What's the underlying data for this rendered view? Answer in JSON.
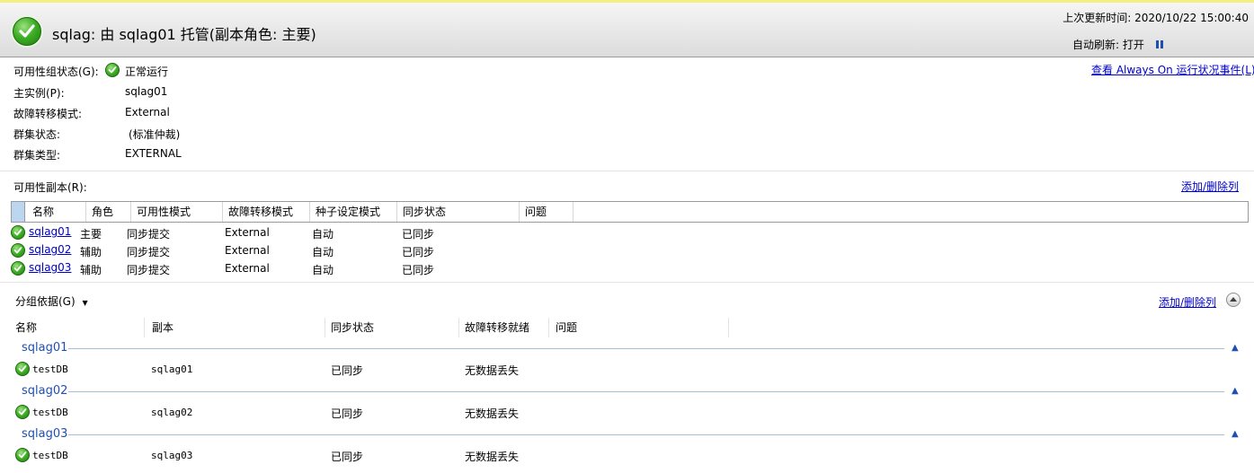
{
  "header": {
    "title": "sqlag: 由 sqlag01 托管(副本角色: 主要)",
    "last_update": "上次更新时间: 2020/10/22 15:00:40",
    "auto_refresh": "自动刷新: 打开"
  },
  "summary": {
    "state_label": "可用性组状态(G):",
    "state_value": "正常运行",
    "primary_label": "主实例(P):",
    "primary_value": "sqlag01",
    "failover_label": "故障转移模式:",
    "failover_value": "External",
    "cluster_state_label": "群集状态:",
    "cluster_state_value": "(标准仲裁)",
    "cluster_type_label": "群集类型:",
    "cluster_type_value": "EXTERNAL",
    "events_link": "查看 Always On 运行状况事件(L)"
  },
  "replicas": {
    "label": "可用性副本(R):",
    "add_remove": "添加/删除列",
    "columns": [
      "名称",
      "角色",
      "可用性模式",
      "故障转移模式",
      "种子设定模式",
      "同步状态",
      "问题"
    ],
    "rows": [
      {
        "name": "sqlag01",
        "role": "主要",
        "avail": "同步提交",
        "failover": "External",
        "seed": "自动",
        "sync": "已同步"
      },
      {
        "name": "sqlag02",
        "role": "辅助",
        "avail": "同步提交",
        "failover": "External",
        "seed": "自动",
        "sync": "已同步"
      },
      {
        "name": "sqlag03",
        "role": "辅助",
        "avail": "同步提交",
        "failover": "External",
        "seed": "自动",
        "sync": "已同步"
      }
    ]
  },
  "databases": {
    "group_by": "分组依据(G)",
    "add_remove": "添加/删除列",
    "columns": [
      "名称",
      "副本",
      "同步状态",
      "故障转移就绪",
      "问题"
    ],
    "groups": [
      {
        "name": "sqlag01",
        "db": "testDB",
        "replica": "sqlag01",
        "sync": "已同步",
        "ready": "无数据丢失"
      },
      {
        "name": "sqlag02",
        "db": "testDB",
        "replica": "sqlag02",
        "sync": "已同步",
        "ready": "无数据丢失"
      },
      {
        "name": "sqlag03",
        "db": "testDB",
        "replica": "sqlag03",
        "sync": "已同步",
        "ready": "无数据丢失"
      }
    ]
  },
  "colors": {
    "link": "#0000cc",
    "group": "#1f4fb5",
    "ok": "#3fae25"
  }
}
